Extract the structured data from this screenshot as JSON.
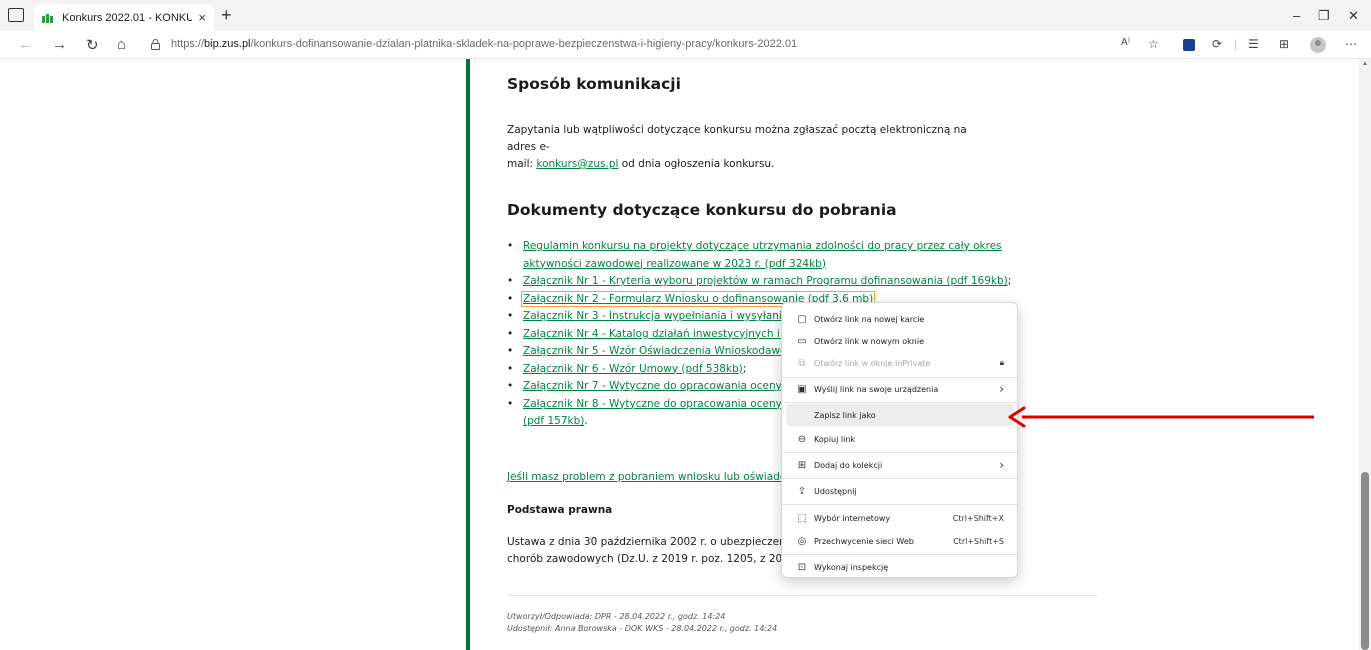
{
  "browser": {
    "tab_title": "Konkurs 2022.01 - KONKURS Do",
    "tab_close": "×",
    "new_tab": "+",
    "url_prefix": "https://",
    "url_host": "bip.zus.pl",
    "url_path": "/konkurs-dofinansowanie-dzialan-platnika-skladek-na-poprawe-bezpieczenstwa-i-higieny-pracy/konkurs-2022.01",
    "window_controls": {
      "minimize": "–",
      "restore": "❐",
      "close": "✕"
    },
    "nav": {
      "back": "←",
      "forward": "→",
      "refresh": "↻",
      "home": "⌂"
    },
    "toolbar_icons": [
      "read-aloud-icon",
      "favorites-icon",
      "extension-icon",
      "sync-icon",
      "collections-icon",
      "profile-icon",
      "more-icon"
    ],
    "read_aloud_glyph": "A⁾",
    "more_glyph": "⋯"
  },
  "page": {
    "comm_heading": "Sposób komunikacji",
    "comm_text_1": "Zapytania lub wątpliwości dotyczące konkursu można zgłaszać pocztą elektroniczną na adres e-",
    "comm_text_2a": "mail: ",
    "comm_email": "konkurs@zus.pl",
    "comm_text_2b": " od dnia ogłoszenia konkursu.",
    "docs_heading": "Dokumenty dotyczące konkursu do pobrania",
    "docs": [
      {
        "line1": "Regulamin konkursu na projekty dotyczące utrzymania zdolności do pracy przez cały okres",
        "line2": "aktywności zawodowej realizowane w 2023 r. (pdf 324kb)"
      },
      {
        "line1": "Załącznik Nr 1 - Kryteria wyboru projektów w ramach Programu dofinansowania (pdf 169kb)",
        "suffix": ";"
      },
      {
        "line1": "Załącznik Nr 2 - Formularz Wniosku o dofinansowanie (pdf 3,6 mb)"
      },
      {
        "line1": "Załącznik Nr 3 - Instrukcja wypełniania i wysyłania W"
      },
      {
        "line1": "Załącznik Nr 4 - Katalog działań inwestycyjnych i dor"
      },
      {
        "line1": "Załącznik Nr 5 - Wzór Oświadczenia Wnioskodawcy"
      },
      {
        "line1": "Załącznik Nr 6 - Wzór Umowy (pdf 538kb)",
        "suffix": ";"
      },
      {
        "line1": "Załącznik Nr 7 - Wytyczne do opracowania oceny ry"
      },
      {
        "line1": "Załącznik Nr 8 - Wytyczne do opracowania oceny ob",
        "line2": "(pdf 157kb)",
        "line2_suffix": "."
      }
    ],
    "problem_link": "Jeśli masz problem z pobraniem wniosku lub oświadczen",
    "legal_heading": "Podstawa prawna",
    "legal_text_1": "Ustawa z dnia 30 października 2002 r. o ubezpieczeniu s",
    "legal_text_2": "chorób zawodowych (Dz.U. z 2019 r. poz. 1205, z 2021",
    "meta_created": "Utworzył/Odpowiada: DPR - 28.04.2022 r., godz. 14:24",
    "meta_shared": "Udostępnił: Anna Borowska - DOK WKS - 28.04.2022 r., godz. 14:24"
  },
  "context_menu": {
    "items": [
      {
        "label": "Otwórz link na nowej karcie",
        "icon": "new-tab-icon",
        "glyph": "▢"
      },
      {
        "label": "Otwórz link w nowym oknie",
        "icon": "new-window-icon",
        "glyph": "▭"
      },
      {
        "label": "Otwórz link w oknie InPrivate",
        "icon": "inprivate-icon",
        "glyph": "⧉",
        "right_glyph": "🔒︎"
      },
      {
        "label": "Wyślij link na swoje urządzenia",
        "icon": "send-to-devices-icon",
        "glyph": "▣",
        "right_glyph": "›"
      },
      {
        "label": "Zapisz link jako",
        "icon": "",
        "glyph": ""
      },
      {
        "label": "Kopiuj link",
        "icon": "link-icon",
        "glyph": "⊖"
      },
      {
        "label": "Dodaj do kolekcji",
        "icon": "collections-icon",
        "glyph": "⊞",
        "right_glyph": "›"
      },
      {
        "label": "Udostępnij",
        "icon": "share-icon",
        "glyph": "⇪"
      },
      {
        "label": "Wybór internetowy",
        "icon": "web-select-icon",
        "glyph": "⬚",
        "shortcut": "Ctrl+Shift+X"
      },
      {
        "label": "Przechwycenie sieci Web",
        "icon": "web-capture-icon",
        "glyph": "◎",
        "shortcut": "Ctrl+Shift+S"
      },
      {
        "label": "Wykonaj inspekcję",
        "icon": "inspect-icon",
        "glyph": "⊡"
      }
    ]
  },
  "colors": {
    "accent_green": "#00843d",
    "rule_green": "#007834",
    "arrow_red": "#e00000",
    "focus_orange": "#f5a623"
  }
}
